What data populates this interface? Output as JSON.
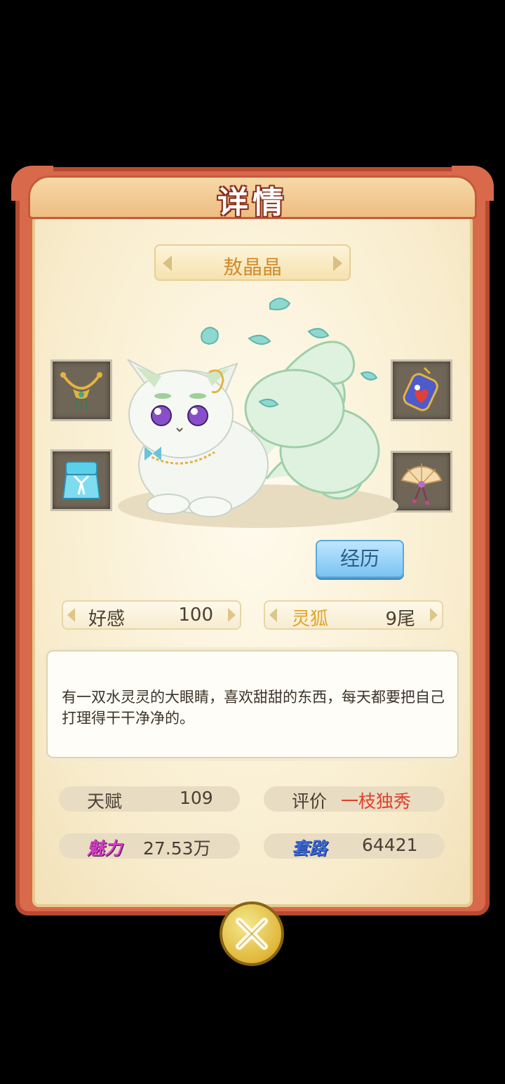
{
  "dialog": {
    "title": "详情",
    "name": "敖晶晶",
    "experience_button": "经历",
    "affection": {
      "label": "好感",
      "value": "100"
    },
    "species": {
      "label": "灵狐",
      "value": "9尾"
    },
    "description": "有一双水灵灵的大眼睛，喜欢甜甜的东西，每天都要把自己打理得干干净净的。",
    "stats": {
      "talent": {
        "label": "天赋",
        "value": "109"
      },
      "rating": {
        "label": "评价",
        "value": "一枝独秀"
      },
      "charm": {
        "label": "魅力",
        "value": "27.53万"
      },
      "tactics": {
        "label": "套路",
        "value": "64421"
      }
    }
  },
  "equipment": [
    {
      "slot": "top-left",
      "icon": "necklace-icon"
    },
    {
      "slot": "bottom-left",
      "icon": "clothing-icon"
    },
    {
      "slot": "top-right",
      "icon": "pouch-icon"
    },
    {
      "slot": "bottom-right",
      "icon": "folding-fan-icon"
    }
  ],
  "colors": {
    "frame": "#d8694a",
    "panel": "#f8eccc",
    "name_text": "#d08a2a",
    "species_text": "#e0a52a",
    "rating_text": "#e0402a",
    "charm_label": "#d63cc8",
    "tactics_label": "#3a6ad8",
    "button_blue": "#79c3f2"
  }
}
